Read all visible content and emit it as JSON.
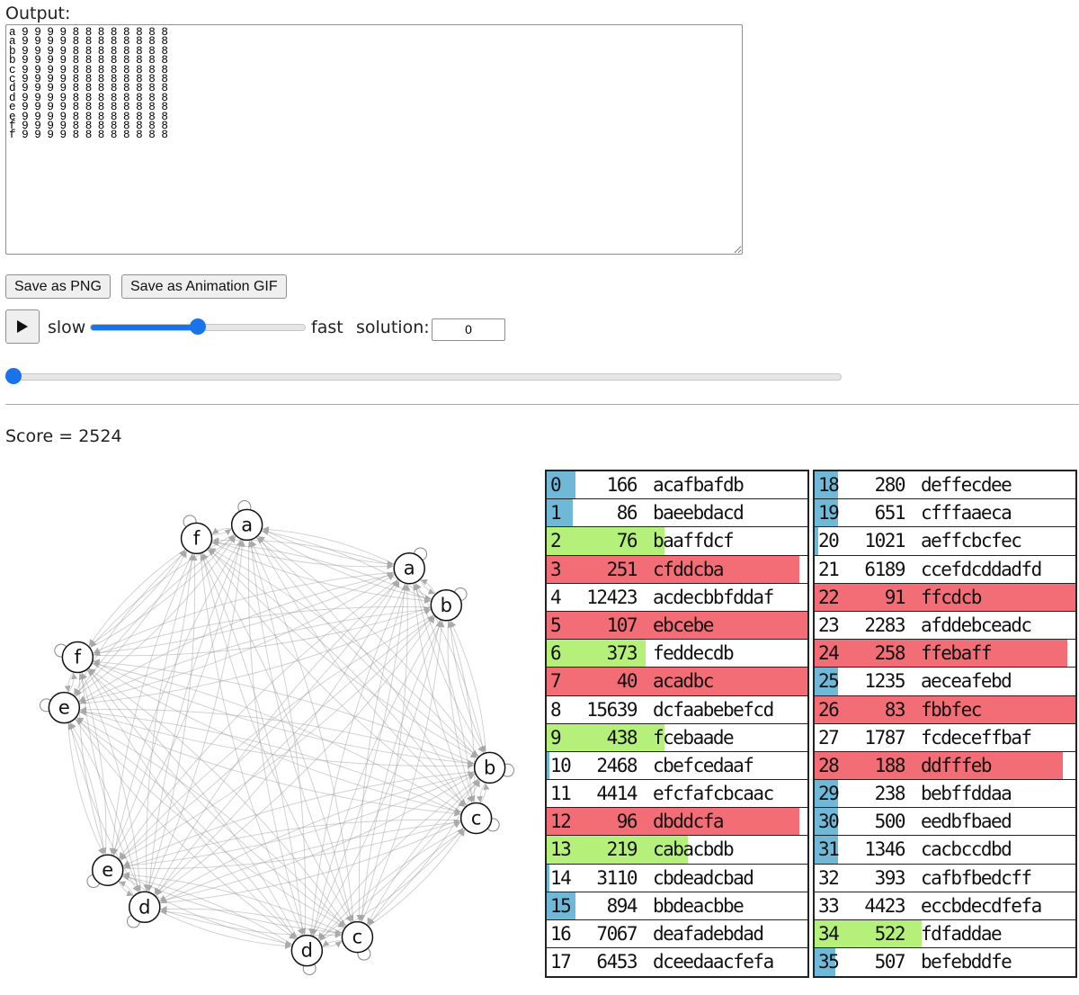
{
  "output": {
    "label": "Output:",
    "text": "a 9 9 9 9 8 8 8 8 8 8 8 8\na 9 9 9 9 8 8 8 8 8 8 8 8\nb 9 9 9 9 8 8 8 8 8 8 8 8\nb 9 9 9 9 8 8 8 8 8 8 8 8\nc 9 9 9 9 8 8 8 8 8 8 8 8\nc 9 9 9 9 8 8 8 8 8 8 8 8\nd 9 9 9 9 8 8 8 8 8 8 8 8\nd 9 9 9 9 8 8 8 8 8 8 8 8\ne 9 9 9 9 8 8 8 8 8 8 8 8\ne 9 9 9 9 8 8 8 8 8 8 8 8\nf 9 9 9 9 8 8 8 8 8 8 8 8\nf 9 9 9 9 8 8 8 8 8 8 8 8"
  },
  "buttons": {
    "save_png": "Save as PNG",
    "save_gif": "Save as Animation GIF"
  },
  "controls": {
    "slow_label": "slow",
    "fast_label": "fast",
    "solution_label": "solution:",
    "solution_value": "0",
    "speed_value": 0.5,
    "seek_value": 0
  },
  "score": {
    "text": "Score = 2524"
  },
  "colors": {
    "blue": "#6fb8d8",
    "green": "#b4f07a",
    "red": "#f26d75",
    "node_stroke": "#111111",
    "edge": "#999999",
    "slider": "#1a73e8"
  },
  "graph": {
    "nodes": [
      "a",
      "a",
      "b",
      "b",
      "c",
      "c",
      "d",
      "d",
      "e",
      "e",
      "f",
      "f"
    ]
  },
  "table_left": [
    {
      "idx": "0",
      "num": "166",
      "str": "acafbafdb",
      "bar": "blue",
      "fill": 0.11
    },
    {
      "idx": "1",
      "num": "86",
      "str": "baeebdacd",
      "bar": "blue",
      "fill": 0.1
    },
    {
      "idx": "2",
      "num": "76",
      "str": "baaffdcf",
      "bar": "green",
      "fill": 0.45
    },
    {
      "idx": "3",
      "num": "251",
      "str": "cfddcba",
      "bar": "red",
      "fill": 0.97
    },
    {
      "idx": "4",
      "num": "12423",
      "str": "acdecbbfddaf",
      "bar": "none",
      "fill": 0
    },
    {
      "idx": "5",
      "num": "107",
      "str": "ebcebe",
      "bar": "red",
      "fill": 1.0
    },
    {
      "idx": "6",
      "num": "373",
      "str": "feddecdb",
      "bar": "green",
      "fill": 0.38
    },
    {
      "idx": "7",
      "num": "40",
      "str": "acadbc",
      "bar": "red",
      "fill": 1.0
    },
    {
      "idx": "8",
      "num": "15639",
      "str": "dcfaabebefcd",
      "bar": "none",
      "fill": 0
    },
    {
      "idx": "9",
      "num": "438",
      "str": "fcebaade",
      "bar": "green",
      "fill": 0.45
    },
    {
      "idx": "10",
      "num": "2468",
      "str": "cbefcedaaf",
      "bar": "blue",
      "fill": 0.012
    },
    {
      "idx": "11",
      "num": "4414",
      "str": "efcfafcbcaac",
      "bar": "none",
      "fill": 0
    },
    {
      "idx": "12",
      "num": "96",
      "str": "dbddcfa",
      "bar": "red",
      "fill": 0.97
    },
    {
      "idx": "13",
      "num": "219",
      "str": "cabacbdb",
      "bar": "green",
      "fill": 0.54
    },
    {
      "idx": "14",
      "num": "3110",
      "str": "cbdeadcbad",
      "bar": "blue",
      "fill": 0.012
    },
    {
      "idx": "15",
      "num": "894",
      "str": "bbdeacbbe",
      "bar": "blue",
      "fill": 0.11
    },
    {
      "idx": "16",
      "num": "7067",
      "str": "deafadebdad",
      "bar": "none",
      "fill": 0
    },
    {
      "idx": "17",
      "num": "6453",
      "str": "dceedaacfefa",
      "bar": "none",
      "fill": 0
    }
  ],
  "table_right": [
    {
      "idx": "18",
      "num": "280",
      "str": "deffecdee",
      "bar": "blue",
      "fill": 0.09
    },
    {
      "idx": "19",
      "num": "651",
      "str": "cfffaaeca",
      "bar": "blue",
      "fill": 0.09
    },
    {
      "idx": "20",
      "num": "1021",
      "str": "aeffcbcfec",
      "bar": "blue",
      "fill": 0.015
    },
    {
      "idx": "21",
      "num": "6189",
      "str": "ccefdcddadfd",
      "bar": "none",
      "fill": 0
    },
    {
      "idx": "22",
      "num": "91",
      "str": "ffcdcb",
      "bar": "red",
      "fill": 1.0
    },
    {
      "idx": "23",
      "num": "2283",
      "str": "afddebceadc",
      "bar": "none",
      "fill": 0
    },
    {
      "idx": "24",
      "num": "258",
      "str": "ffebaff",
      "bar": "red",
      "fill": 0.97
    },
    {
      "idx": "25",
      "num": "1235",
      "str": "aeceafebd",
      "bar": "blue",
      "fill": 0.09
    },
    {
      "idx": "26",
      "num": "83",
      "str": "fbbfec",
      "bar": "red",
      "fill": 1.0
    },
    {
      "idx": "27",
      "num": "1787",
      "str": "fcdeceffbaf",
      "bar": "none",
      "fill": 0
    },
    {
      "idx": "28",
      "num": "188",
      "str": "ddfffeb",
      "bar": "red",
      "fill": 0.95
    },
    {
      "idx": "29",
      "num": "238",
      "str": "bebffddaa",
      "bar": "blue",
      "fill": 0.09
    },
    {
      "idx": "30",
      "num": "500",
      "str": "eedbfbaed",
      "bar": "blue",
      "fill": 0.09
    },
    {
      "idx": "31",
      "num": "1346",
      "str": "cacbccdbd",
      "bar": "blue",
      "fill": 0.09
    },
    {
      "idx": "32",
      "num": "393",
      "str": "cafbfbedcff",
      "bar": "none",
      "fill": 0
    },
    {
      "idx": "33",
      "num": "4423",
      "str": "eccbdecdfefa",
      "bar": "none",
      "fill": 0
    },
    {
      "idx": "34",
      "num": "522",
      "str": "fdfaddae",
      "bar": "green",
      "fill": 0.41
    },
    {
      "idx": "35",
      "num": "507",
      "str": "befebddfe",
      "bar": "blue",
      "fill": 0.08
    }
  ]
}
